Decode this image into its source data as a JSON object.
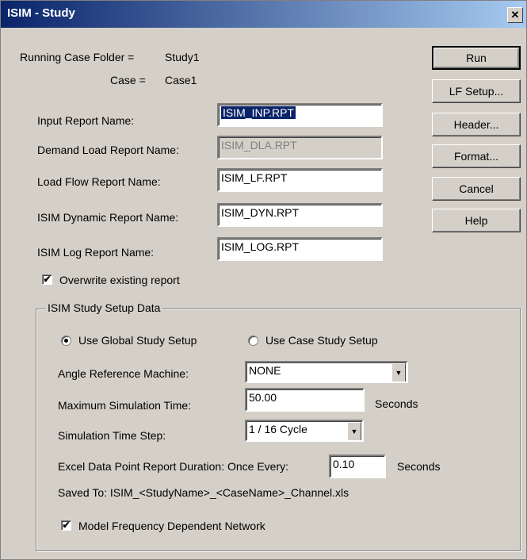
{
  "window": {
    "title": "ISIM - Study",
    "close_glyph": "✕"
  },
  "info": {
    "running_case_folder_label": "Running Case Folder =",
    "running_case_folder_value": "Study1",
    "case_label": "Case =",
    "case_value": "Case1"
  },
  "reports": {
    "input_label": "Input Report Name:",
    "input_value": "ISIM_INP.RPT",
    "demand_label": "Demand Load Report Name:",
    "demand_value": "ISIM_DLA.RPT",
    "loadflow_label": "Load Flow Report Name:",
    "loadflow_value": "ISIM_LF.RPT",
    "dynamic_label": "ISIM Dynamic Report Name:",
    "dynamic_value": "ISIM_DYN.RPT",
    "log_label": "ISIM Log Report Name:",
    "log_value": "ISIM_LOG.RPT",
    "overwrite_label": "Overwrite existing report",
    "overwrite_checked": true
  },
  "buttons": {
    "run": "Run",
    "lf_setup": "LF Setup...",
    "header": "Header...",
    "format": "Format...",
    "cancel": "Cancel",
    "help": "Help"
  },
  "setup": {
    "group_title": "ISIM Study Setup Data",
    "global_label": "Use Global Study Setup",
    "case_label": "Use Case Study Setup",
    "selected": "global",
    "angle_label": "Angle Reference Machine:",
    "angle_value": "NONE",
    "max_time_label": "Maximum Simulation Time:",
    "max_time_value": "50.00",
    "max_time_unit": "Seconds",
    "step_label": "Simulation Time Step:",
    "step_value": "1 / 16 Cycle",
    "excel_label": "Excel Data Point Report Duration: Once Every:",
    "excel_value": "0.10",
    "excel_unit": "Seconds",
    "saved_to": "Saved To: ISIM_<StudyName>_<CaseName>_Channel.xls",
    "freq_label": "Model Frequency Dependent Network",
    "freq_checked": true
  },
  "icons": {
    "check": "✔",
    "dropdown": "▼"
  }
}
